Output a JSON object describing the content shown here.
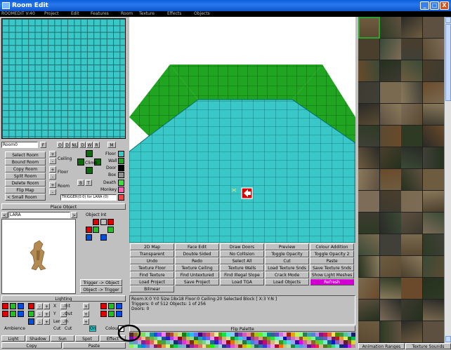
{
  "window": {
    "title": "Room Edit",
    "min": "_",
    "max": "□",
    "close": "X"
  },
  "menu": {
    "roomstate": "ROOMEDIT V:40",
    "items": [
      "Project",
      "Edit",
      "Features",
      "Room",
      "Texture",
      "Effects",
      "Objects"
    ]
  },
  "room": {
    "name": "Room0",
    "flags": [
      "F",
      "O",
      "D",
      "NL",
      "D",
      "W",
      "R",
      "M"
    ],
    "buttons": [
      "Select Room",
      "Bound Room",
      "Copy Room",
      "Split Room",
      "Delete Room",
      "Flip Map"
    ],
    "size": "Small Room",
    "labels": {
      "ceiling": "Ceiling",
      "climb": "Climb",
      "floor": "Floor",
      "room": "Room",
      "b": "B",
      "t": "T"
    },
    "swatch_labels": [
      "Floor",
      "Wall",
      "Door",
      "Box",
      "Death",
      "Monkey"
    ],
    "trigger_text": "TRIGGER(0:0) for LARA (0)"
  },
  "place_object": {
    "title": "Place Object",
    "selector_left": "<",
    "name": "LARA",
    "selector_right": ">",
    "obj_int": "Object Int",
    "trigger_to_object": "Trigger -> Object",
    "object_to_trigger": "Object -> Trigger"
  },
  "lighting": {
    "title": "Lighting",
    "axes": [
      "X",
      "Y",
      "Len",
      "Cut"
    ],
    "axis_right": [
      "Int",
      "Out",
      "In",
      "Cut"
    ],
    "ambience": "Ambience",
    "colour": "Colour",
    "on": "On",
    "bottom_buttons": [
      "Light",
      "Shadow",
      "Sun",
      "Spot",
      "Effect"
    ],
    "copy": "Copy",
    "paste": "Paste"
  },
  "toolbar": {
    "rows": [
      [
        "2D Map",
        "Face Edit",
        "Draw Doors",
        "Preview",
        "Colour Addition"
      ],
      [
        "Transparent",
        "Double Sided",
        "No Collision",
        "Toggle Opacity",
        "Toggle Opacity 2"
      ],
      [
        "Undo",
        "Redo",
        "Select All",
        "Cut",
        "Paste"
      ],
      [
        "Texture Floor",
        "Texture Ceiling",
        "Texture Walls",
        "Load Texture Snds",
        "Save Texture Snds"
      ],
      [
        "Find Texture",
        "Find Untextured",
        "Find Illegal Slope",
        "Crack Mode",
        "Show Light Meshes"
      ],
      [
        "Load Project",
        "Save Project",
        "Load TGA",
        "Load Objects",
        "Refresh"
      ],
      [
        "Bilinear"
      ]
    ]
  },
  "status": {
    "line1": "Room:X:0 Y:0     Size:18x18     Floor:0 Ceiling:20     Selected Block [ X:3 Y:N ]",
    "line2": "Triggers: 0 of 512   Objects: 1 of 256",
    "line3": "Doors: 0"
  },
  "flip_palette": "Flip Palette",
  "texture_tabs": {
    "animation": "Animation Ranges",
    "sounds": "Texture Sounds"
  },
  "colors": {
    "cyan": "#39c7c7",
    "green": "#1fa51f",
    "refresh": "#d000d0",
    "red": "#e00000"
  }
}
